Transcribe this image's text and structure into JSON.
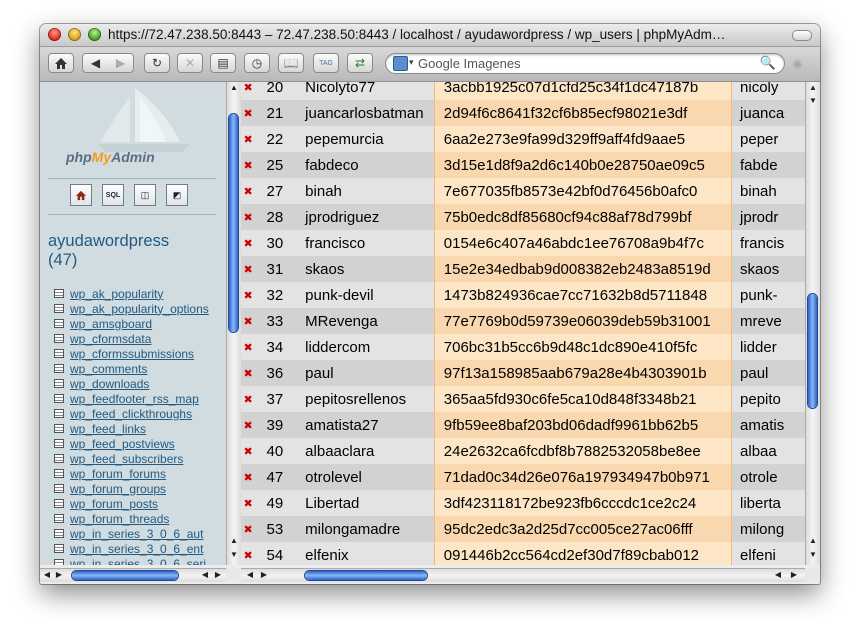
{
  "window": {
    "title": "https://72.47.238.50:8443 – 72.47.238.50:8443 / localhost / ayudawordpress  / wp_users | phpMyAdm…"
  },
  "toolbar": {
    "search_placeholder": "Google Imagenes",
    "search_drop": "▾"
  },
  "sidebar": {
    "logo_php": "php",
    "logo_my": "My",
    "logo_admin": "Admin",
    "database": "ayudawordpress",
    "table_count": "(47)",
    "tables": [
      "wp_ak_popularity",
      "wp_ak_popularity_options",
      "wp_amsgboard",
      "wp_cformsdata",
      "wp_cformssubmissions",
      "wp_comments",
      "wp_downloads",
      "wp_feedfooter_rss_map",
      "wp_feed_clickthroughs",
      "wp_feed_links",
      "wp_feed_postviews",
      "wp_feed_subscribers",
      "wp_forum_forums",
      "wp_forum_groups",
      "wp_forum_posts",
      "wp_forum_threads",
      "wp_in_series_3_0_6_aut",
      "wp_in_series_3_0_6_ent",
      "wp_in_series_3_0_6_seri"
    ],
    "icons": [
      "home-icon",
      "sql-icon",
      "query-window-icon",
      "documentation-icon"
    ]
  },
  "users": {
    "rows": [
      {
        "id": "20",
        "login": "Nicolyto77",
        "pass": "3acbb1925c07d1cfd25c34f1dc47187b",
        "nicename": "nicoly"
      },
      {
        "id": "21",
        "login": "juancarlosbatman",
        "pass": "2d94f6c8641f32cf6b85ecf98021e3df",
        "nicename": "juanca"
      },
      {
        "id": "22",
        "login": "pepemurcia",
        "pass": "6aa2e273e9fa99d329ff9aff4fd9aae5",
        "nicename": "peper"
      },
      {
        "id": "25",
        "login": "fabdeco",
        "pass": "3d15e1d8f9a2d6c140b0e28750ae09c5",
        "nicename": "fabde"
      },
      {
        "id": "27",
        "login": "binah",
        "pass": "7e677035fb8573e42bf0d76456b0afc0",
        "nicename": "binah"
      },
      {
        "id": "28",
        "login": "jprodriguez",
        "pass": "75b0edc8df85680cf94c88af78d799bf",
        "nicename": "jprodr"
      },
      {
        "id": "30",
        "login": "francisco",
        "pass": "0154e6c407a46abdc1ee76708a9b4f7c",
        "nicename": "francis"
      },
      {
        "id": "31",
        "login": "skaos",
        "pass": "15e2e34edbab9d008382eb2483a8519d",
        "nicename": "skaos"
      },
      {
        "id": "32",
        "login": "punk-devil",
        "pass": "1473b824936cae7cc71632b8d5711848",
        "nicename": "punk-"
      },
      {
        "id": "33",
        "login": "MRevenga",
        "pass": "77e7769b0d59739e06039deb59b31001",
        "nicename": "mreve"
      },
      {
        "id": "34",
        "login": "liddercom",
        "pass": "706bc31b5cc6b9d48c1dc890e410f5fc",
        "nicename": "lidder"
      },
      {
        "id": "36",
        "login": "paul",
        "pass": "97f13a158985aab679a28e4b4303901b",
        "nicename": "paul"
      },
      {
        "id": "37",
        "login": "pepitosrellenos",
        "pass": "365aa5fd930c6fe5ca10d848f3348b21",
        "nicename": "pepito"
      },
      {
        "id": "39",
        "login": "amatista27",
        "pass": "9fb59ee8baf203bd06dadf9961bb62b5",
        "nicename": "amatis"
      },
      {
        "id": "40",
        "login": "albaaclara",
        "pass": "24e2632ca6fcdbf8b7882532058be8ee",
        "nicename": "albaa"
      },
      {
        "id": "47",
        "login": "otrolevel",
        "pass": "71dad0c34d26e076a197934947b0b971",
        "nicename": "otrole"
      },
      {
        "id": "49",
        "login": "Libertad",
        "pass": "3df423118172be923fb6cccdc1ce2c24",
        "nicename": "liberta"
      },
      {
        "id": "53",
        "login": "milongamadre",
        "pass": "95dc2edc3a2d25d7cc005ce27ac06fff",
        "nicename": "milong"
      },
      {
        "id": "54",
        "login": "elfenix",
        "pass": "091446b2cc564cd2ef30d7f89cbab012",
        "nicename": "elfeni"
      }
    ]
  }
}
